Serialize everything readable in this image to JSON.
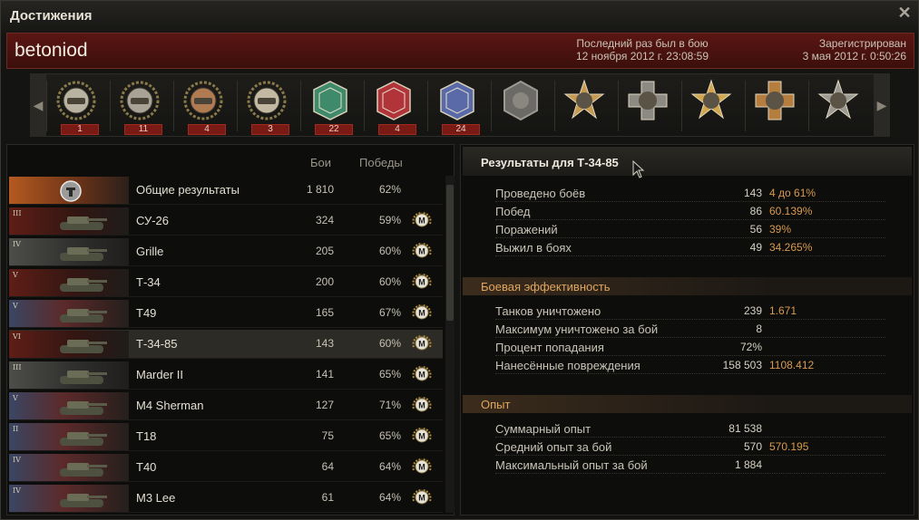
{
  "window": {
    "title": "Достижения"
  },
  "header": {
    "nickname": "betoniod",
    "last_battle_label": "Последний раз был в бою",
    "last_battle_value": "12 ноября 2012 г. 23:08:59",
    "registered_label": "Зарегистрирован",
    "registered_value": "3 мая 2012 г. 0:50:26"
  },
  "medals": [
    {
      "icon": "tank-ace-badge-icon",
      "count": "1"
    },
    {
      "icon": "first-class-badge-icon",
      "count": "11"
    },
    {
      "icon": "second-class-badge-icon",
      "count": "4"
    },
    {
      "icon": "third-class-badge-icon",
      "count": "3"
    },
    {
      "icon": "warrior-medal-icon",
      "count": "22"
    },
    {
      "icon": "invader-medal-icon",
      "count": "4"
    },
    {
      "icon": "sniper-medal-icon",
      "count": "24"
    },
    {
      "icon": "hero-hexagon-medal-icon",
      "count": ""
    },
    {
      "icon": "portrait-cross-medal-icon",
      "count": ""
    },
    {
      "icon": "portrait-star-medal-icon",
      "count": ""
    },
    {
      "icon": "portrait-star-gold-medal-icon",
      "count": ""
    },
    {
      "icon": "portrait-cross-bronze-medal-icon",
      "count": ""
    },
    {
      "icon": "portrait-star-silver-medal-icon",
      "count": ""
    }
  ],
  "tank_list": {
    "col_battles": "Бои",
    "col_wins": "Победы",
    "rows": [
      {
        "tier": "",
        "nation": "overall",
        "name": "Общие результаты",
        "battles": "1 810",
        "wins": "62%",
        "master": false
      },
      {
        "tier": "III",
        "nation": "ussr",
        "name": "СУ-26",
        "battles": "324",
        "wins": "59%",
        "master": true
      },
      {
        "tier": "IV",
        "nation": "ger",
        "name": "Grille",
        "battles": "205",
        "wins": "60%",
        "master": true
      },
      {
        "tier": "V",
        "nation": "ussr",
        "name": "Т-34",
        "battles": "200",
        "wins": "60%",
        "master": true
      },
      {
        "tier": "V",
        "nation": "usa",
        "name": "T49",
        "battles": "165",
        "wins": "67%",
        "master": true
      },
      {
        "tier": "VI",
        "nation": "ussr",
        "name": "Т-34-85",
        "battles": "143",
        "wins": "60%",
        "master": true
      },
      {
        "tier": "III",
        "nation": "ger",
        "name": "Marder II",
        "battles": "141",
        "wins": "65%",
        "master": true
      },
      {
        "tier": "V",
        "nation": "usa",
        "name": "M4 Sherman",
        "battles": "127",
        "wins": "71%",
        "master": true
      },
      {
        "tier": "II",
        "nation": "usa",
        "name": "T18",
        "battles": "75",
        "wins": "65%",
        "master": true
      },
      {
        "tier": "IV",
        "nation": "usa",
        "name": "T40",
        "battles": "64",
        "wins": "64%",
        "master": true
      },
      {
        "tier": "IV",
        "nation": "usa",
        "name": "M3 Lee",
        "battles": "61",
        "wins": "64%",
        "master": true
      }
    ],
    "master_badge": "M"
  },
  "results": {
    "title": "Результаты для Т-34-85",
    "general": [
      {
        "label": "Проведено боёв",
        "value": "143",
        "extra": "4 до 61%"
      },
      {
        "label": "Побед",
        "value": "86",
        "extra": "60.139%"
      },
      {
        "label": "Поражений",
        "value": "56",
        "extra": "39%"
      },
      {
        "label": "Выжил в боях",
        "value": "49",
        "extra": "34.265%"
      }
    ],
    "efficiency_title": "Боевая эффективность",
    "efficiency": [
      {
        "label": "Танков уничтожено",
        "value": "239",
        "extra": "1.671"
      },
      {
        "label": "Максимум уничтожено за бой",
        "value": "8",
        "extra": ""
      },
      {
        "label": "Процент попадания",
        "value": "72%",
        "extra": ""
      },
      {
        "label": "Нанесённые повреждения",
        "value": "158 503",
        "extra": "1108.412"
      }
    ],
    "experience_title": "Опыт",
    "experience": [
      {
        "label": "Суммарный опыт",
        "value": "81 538",
        "extra": ""
      },
      {
        "label": "Средний опыт за бой",
        "value": "570",
        "extra": "570.195"
      },
      {
        "label": "Максимальный опыт за бой",
        "value": "1 884",
        "extra": ""
      }
    ]
  },
  "colors": {
    "accent_orange": "#d99a4e",
    "header_red": "#5a1612",
    "section_orange": "#e0a560"
  }
}
